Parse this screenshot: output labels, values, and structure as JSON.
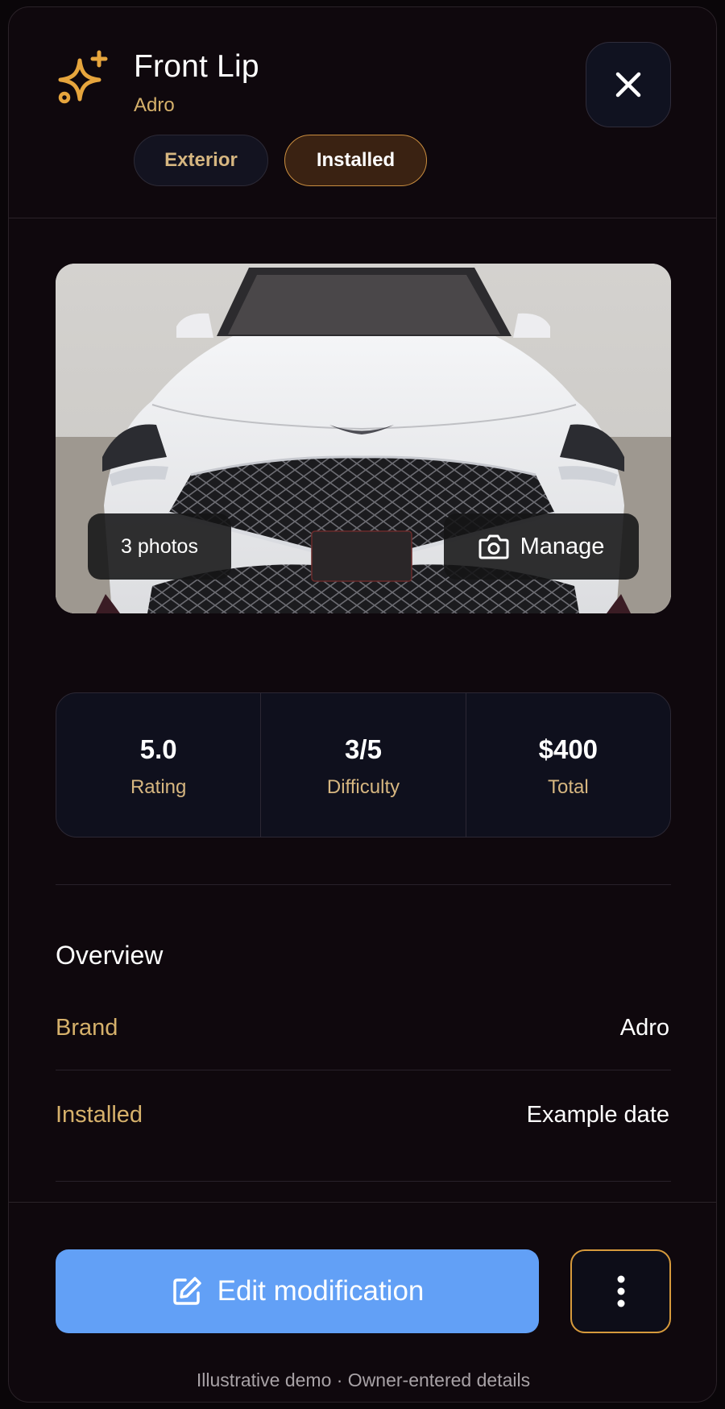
{
  "header": {
    "title": "Front Lip",
    "brand": "Adro",
    "tags": {
      "category": "Exterior",
      "status": "Installed"
    },
    "icon": "sparkle-icon",
    "close_icon": "close-icon"
  },
  "photo": {
    "count_label": "3 photos",
    "manage_label": "Manage",
    "manage_icon": "camera-icon"
  },
  "stats": [
    {
      "value": "5.0",
      "label": "Rating"
    },
    {
      "value": "3/5",
      "label": "Difficulty"
    },
    {
      "value": "$400",
      "label": "Total"
    }
  ],
  "overview": {
    "title": "Overview",
    "rows": [
      {
        "label": "Brand",
        "value": "Adro"
      },
      {
        "label": "Installed",
        "value": "Example date"
      }
    ]
  },
  "actions": {
    "edit_label": "Edit modification",
    "edit_icon": "edit-icon",
    "more_icon": "more-vertical-icon"
  },
  "footnote": "Illustrative demo · Owner-entered details",
  "colors": {
    "accent_gold": "#d6b16b",
    "primary_blue": "#62a0f6",
    "background": "#0f080d"
  }
}
